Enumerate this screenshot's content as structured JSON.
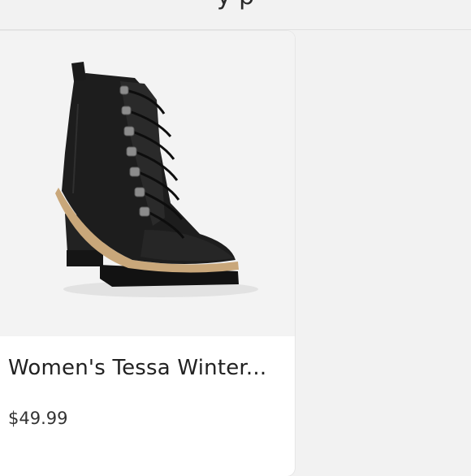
{
  "header": {
    "partial_text": "y    p"
  },
  "product": {
    "title": "Women's Tessa Winter...",
    "price": "$49.99",
    "image_alt": "black lace-up heeled combat boot"
  },
  "colors": {
    "page_bg": "#f2f2f2",
    "card_bg": "#ffffff",
    "boot": "#1d1d1d",
    "welt": "#c9a77a"
  }
}
